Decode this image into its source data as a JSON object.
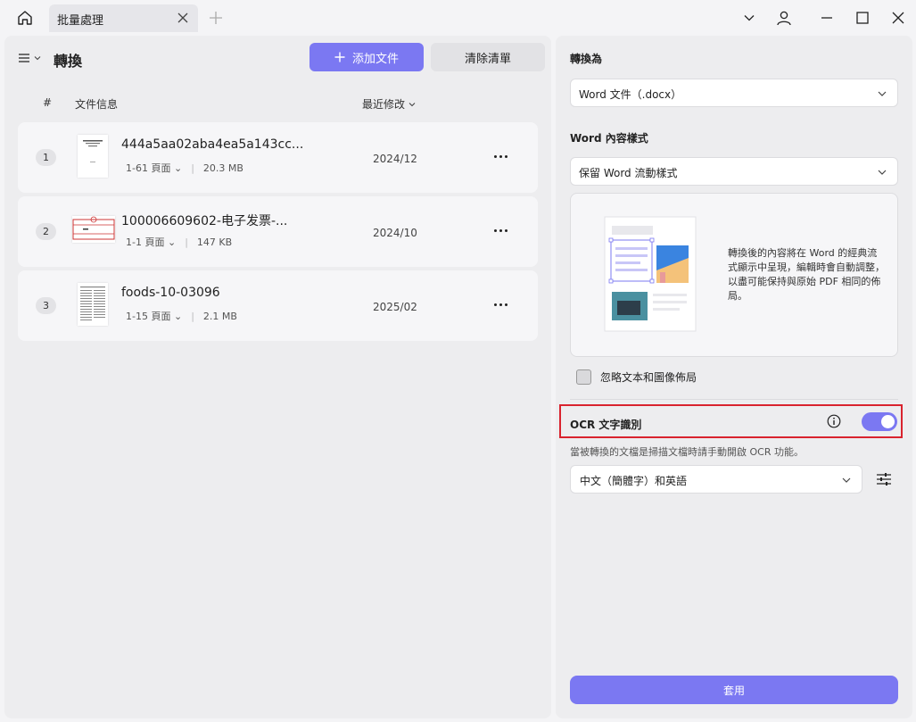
{
  "titlebar": {
    "tab_title": "批量處理"
  },
  "left": {
    "title": "轉換",
    "add_label": "添加文件",
    "clear_label": "清除清單",
    "headers": {
      "num": "#",
      "info": "文件信息",
      "modified": "最近修改"
    },
    "files": [
      {
        "num": "1",
        "name": "444a5aa02aba4ea5a143cc...",
        "pages": "1-61 頁面",
        "size": "20.3 MB",
        "date": "2024/12"
      },
      {
        "num": "2",
        "name": "100006609602-电子发票-...",
        "pages": "1-1 頁面",
        "size": "147 KB",
        "date": "2024/10"
      },
      {
        "num": "3",
        "name": "foods-10-03096",
        "pages": "1-15 頁面",
        "size": "2.1 MB",
        "date": "2025/02"
      }
    ]
  },
  "right": {
    "convert_to_label": "轉換為",
    "format_value": "Word 文件（.docx）",
    "style_label": "Word 內容樣式",
    "style_value": "保留 Word 流動樣式",
    "preview_text": "轉換後的內容將在 Word 的經典流式顯示中呈現，編輯時會自動調整，以盡可能保持與原始 PDF 相同的佈局。",
    "ignore_layout_label": "忽略文本和圖像佈局",
    "ocr_label": "OCR 文字識別",
    "ocr_enabled": true,
    "ocr_desc": "當被轉換的文檔是掃描文檔時請手動開啟 OCR 功能。",
    "lang_value": "中文（簡體字）和英語",
    "apply_label": "套用"
  },
  "colors": {
    "accent": "#7b78f2",
    "highlight": "#d9232e"
  }
}
